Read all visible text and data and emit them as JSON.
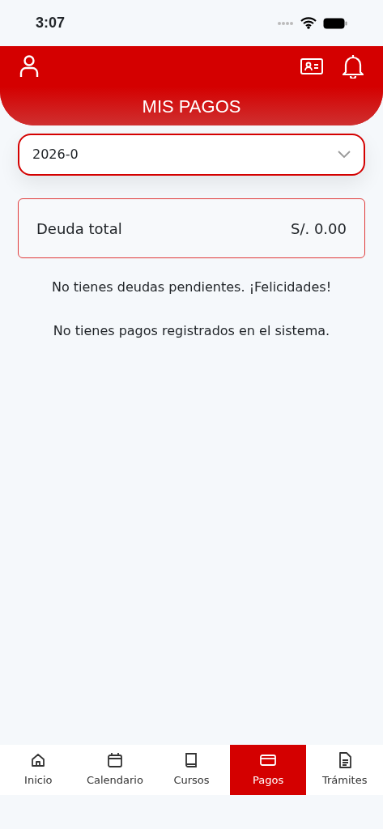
{
  "status_bar": {
    "time": "3:07"
  },
  "header": {
    "title": "MIS PAGOS"
  },
  "period_select": {
    "value": "2026-0"
  },
  "debt_card": {
    "label": "Deuda total",
    "amount": "S/. 0.00"
  },
  "messages": [
    "No tienes deudas pendientes. ¡Felicidades!",
    "No tienes pagos registrados en el sistema."
  ],
  "tabs": [
    {
      "label": "Inicio",
      "kind": "home",
      "selected": false
    },
    {
      "label": "Calendario",
      "kind": "calendar",
      "selected": false
    },
    {
      "label": "Cursos",
      "kind": "book",
      "selected": false
    },
    {
      "label": "Pagos",
      "kind": "card",
      "selected": true
    },
    {
      "label": "Trámites",
      "kind": "document",
      "selected": false
    }
  ]
}
